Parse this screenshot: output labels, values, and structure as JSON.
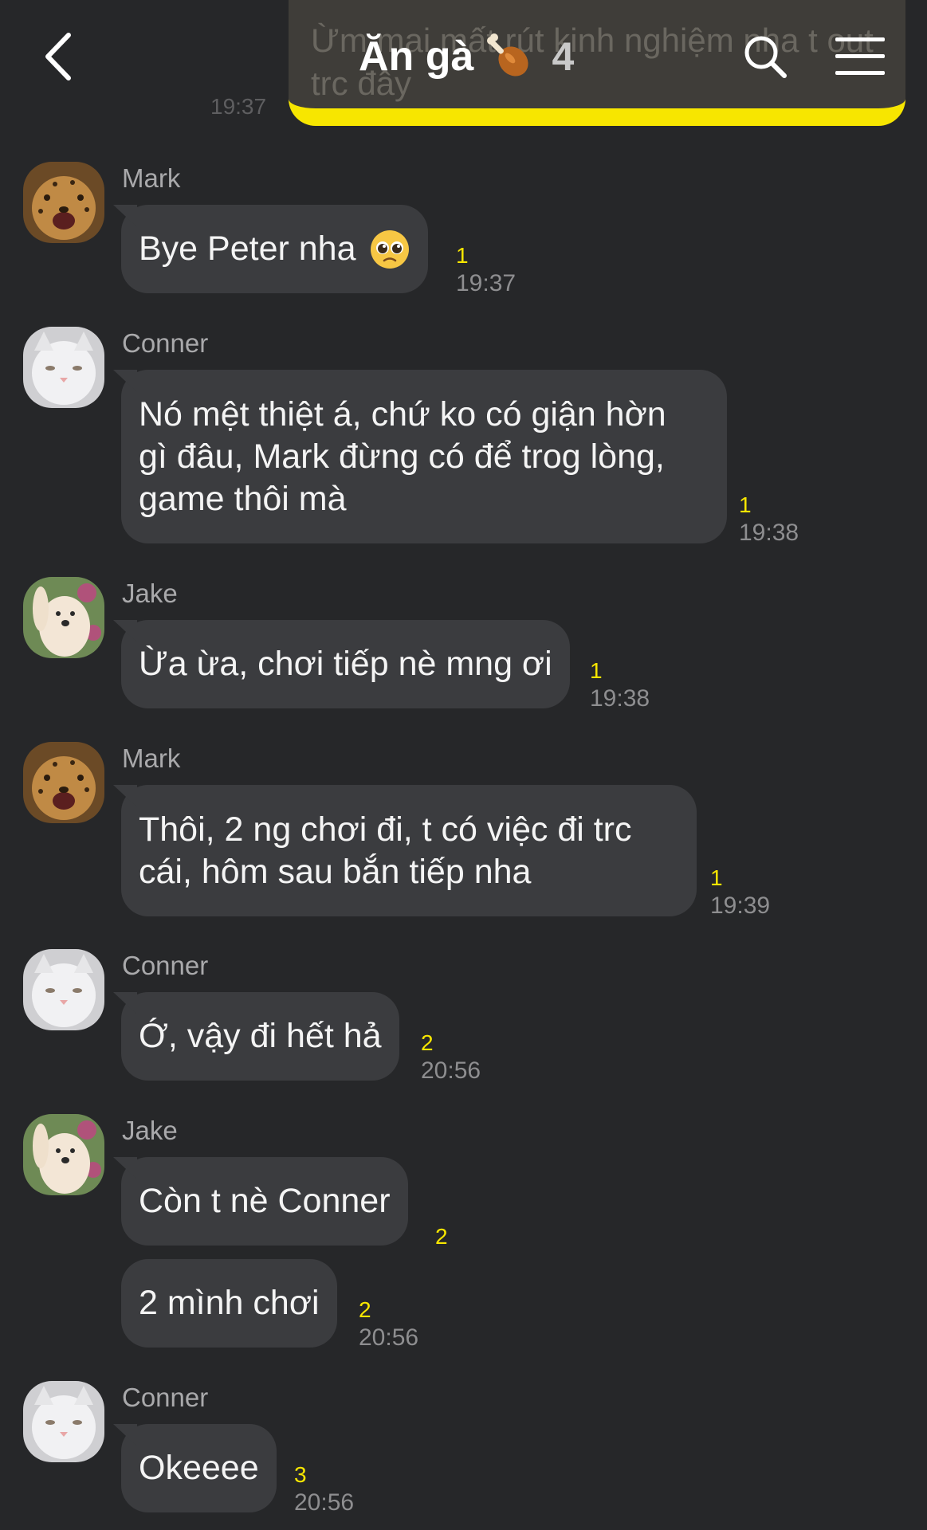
{
  "header": {
    "title": "Ăn gà",
    "title_emoji": "drumstick-icon",
    "member_count": "4",
    "back_icon": "chevron-left-icon",
    "search_icon": "search-icon",
    "menu_icon": "menu-icon",
    "previous_message": "Ừm mai mất rút kinh nghiệm nha t out trc đây",
    "previous_time": "19:37"
  },
  "colors": {
    "background": "#262729",
    "bubble": "#3b3c3f",
    "accent_yellow": "#f7e600",
    "unread": "#f7e600"
  },
  "messages": [
    {
      "sender": "Mark",
      "avatar": "cheetah-avatar",
      "bubbles": [
        {
          "text": "Bye Peter nha",
          "emoji": "pleading-face-emoji",
          "unread": "1",
          "time": "19:37"
        }
      ]
    },
    {
      "sender": "Conner",
      "avatar": "white-cat-avatar",
      "bubbles": [
        {
          "text": "Nó mệt thiệt á, chứ ko có giận hờn\ngì đâu, Mark đừng có để trog lòng,\ngame thôi mà",
          "unread": "1",
          "time": "19:38"
        }
      ]
    },
    {
      "sender": "Jake",
      "avatar": "white-dog-avatar",
      "bubbles": [
        {
          "text": "Ừa ừa, chơi tiếp nè mng ơi",
          "unread": "1",
          "time": "19:38"
        }
      ]
    },
    {
      "sender": "Mark",
      "avatar": "cheetah-avatar",
      "bubbles": [
        {
          "text": "Thôi, 2 ng chơi đi, t có việc đi trc\ncái, hôm sau bắn tiếp nha",
          "unread": "1",
          "time": "19:39"
        }
      ]
    },
    {
      "sender": "Conner",
      "avatar": "white-cat-avatar",
      "bubbles": [
        {
          "text": "Ớ, vậy đi hết hả",
          "unread": "2",
          "time": "20:56"
        }
      ]
    },
    {
      "sender": "Jake",
      "avatar": "white-dog-avatar",
      "bubbles": [
        {
          "text": "Còn t nè Conner",
          "unread": "2",
          "time": ""
        },
        {
          "text": "2 mình chơi",
          "unread": "2",
          "time": "20:56"
        }
      ]
    },
    {
      "sender": "Conner",
      "avatar": "white-cat-avatar",
      "bubbles": [
        {
          "text": "Okeeee",
          "unread": "3",
          "time": "20:56"
        }
      ]
    }
  ]
}
